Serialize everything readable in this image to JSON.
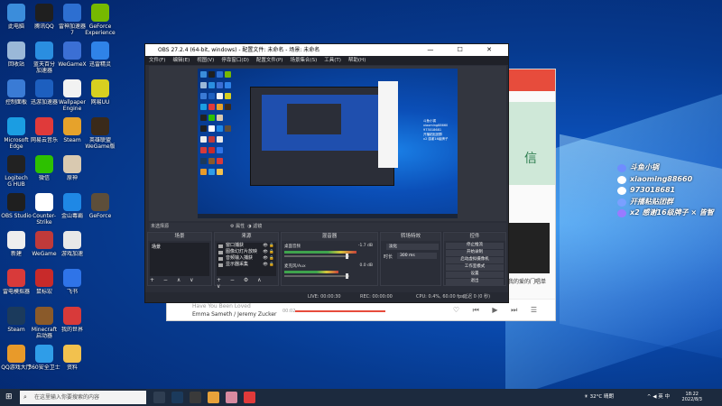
{
  "desktop": {
    "icons": [
      {
        "label": "此电脑",
        "color": "#3b8ddb",
        "col": 0,
        "row": 0
      },
      {
        "label": "腾讯QQ",
        "color": "#1f1f1f",
        "col": 1,
        "row": 0
      },
      {
        "label": "雷神加速器\n7",
        "color": "#2d6fd1",
        "col": 2,
        "row": 0
      },
      {
        "label": "GeForce\nExperience",
        "color": "#76b900",
        "col": 3,
        "row": 0
      },
      {
        "label": "回收站",
        "color": "#9ab8d8",
        "col": 0,
        "row": 1
      },
      {
        "label": "蓝天百分\n加速器",
        "color": "#2a8ee0",
        "col": 1,
        "row": 1
      },
      {
        "label": "WeGameX",
        "color": "#3b6fd4",
        "col": 2,
        "row": 1
      },
      {
        "label": "迅雷精灵",
        "color": "#2f83e8",
        "col": 3,
        "row": 1
      },
      {
        "label": "控制面板",
        "color": "#3a7bd5",
        "col": 0,
        "row": 2
      },
      {
        "label": "迅游加速器",
        "color": "#1d5fbf",
        "col": 1,
        "row": 2
      },
      {
        "label": "Wallpaper\nEngine",
        "color": "#f2f2f2",
        "col": 2,
        "row": 2
      },
      {
        "label": "网易UU",
        "color": "#d8d020",
        "col": 3,
        "row": 2
      },
      {
        "label": "Microsoft\nEdge",
        "color": "#1b9de2",
        "col": 0,
        "row": 3
      },
      {
        "label": "网易云音乐",
        "color": "#e03a3a",
        "col": 1,
        "row": 3
      },
      {
        "label": "Steam",
        "color": "#e6a22b",
        "col": 2,
        "row": 3
      },
      {
        "label": "英雄联盟\nWeGame版",
        "color": "#3a2a1a",
        "col": 3,
        "row": 3
      },
      {
        "label": "Logitech\nG HUB",
        "color": "#222222",
        "col": 0,
        "row": 4
      },
      {
        "label": "微信",
        "color": "#2dc100",
        "col": 1,
        "row": 4
      },
      {
        "label": "原神",
        "color": "#d9c9b0",
        "col": 2,
        "row": 4
      },
      {
        "label": "OBS Studio",
        "color": "#1f1f1f",
        "col": 0,
        "row": 5
      },
      {
        "label": "Counter-\nStrike",
        "color": "#ffffff",
        "col": 1,
        "row": 5
      },
      {
        "label": "金山毒霸",
        "color": "#1f88e5",
        "col": 2,
        "row": 5
      },
      {
        "label": "GeForce",
        "color": "#5d4e3a",
        "col": 3,
        "row": 5
      },
      {
        "label": "新建",
        "color": "#eeeeee",
        "col": 0,
        "row": 6
      },
      {
        "label": "WeGame",
        "color": "#c03a3a",
        "col": 1,
        "row": 6
      },
      {
        "label": "游戏加速",
        "color": "#e8e8e8",
        "col": 2,
        "row": 6
      },
      {
        "label": "雷电模拟器",
        "color": "#d83a3a",
        "col": 0,
        "row": 7
      },
      {
        "label": "鼠标宏",
        "color": "#c82a2a",
        "col": 1,
        "row": 7
      },
      {
        "label": "飞书",
        "color": "#2f74e8",
        "col": 2,
        "row": 7
      },
      {
        "label": "Steam",
        "color": "#1b3a5c",
        "col": 0,
        "row": 8
      },
      {
        "label": "Minecraft\n启动器",
        "color": "#8a5a2a",
        "col": 1,
        "row": 8
      },
      {
        "label": "我的世界",
        "color": "#d83a3a",
        "col": 2,
        "row": 8
      },
      {
        "label": "QQ游戏大厅",
        "color": "#e89a2a",
        "col": 0,
        "row": 9
      },
      {
        "label": "360安全卫士",
        "color": "#2f9de8",
        "col": 1,
        "row": 9
      },
      {
        "label": "资料",
        "color": "#f2c14e",
        "col": 2,
        "row": 9
      }
    ]
  },
  "browser": {
    "green_text": "信",
    "poster_label": "我的爱的门唱单",
    "player": {
      "song": "Have You Been Loved",
      "artist": "Emma Sameth / Jeremy Zucker",
      "time_elapsed": "00:02",
      "time_total": "03:29",
      "controls": "♡ ⏮ ▶ ⏭ ☰"
    }
  },
  "obs": {
    "title": "OBS 27.2.4 (64-bit, windows) - 配置文件: 未命名 - 场景: 未命名",
    "window_controls": "— ☐ ✕",
    "menus": [
      "文件(F)",
      "编辑(E)",
      "视图(V)",
      "停靠窗口(D)",
      "配置文件(P)",
      "场景集合(S)",
      "工具(T)",
      "帮助(H)"
    ],
    "dock_title": "未选择源",
    "dock_props": "⚙ 属性",
    "dock_filters": "◑ 滤镜",
    "scenes": {
      "title": "场景",
      "items": [
        "场景"
      ],
      "footer": "+ − ∧ ∨"
    },
    "sources": {
      "title": "来源",
      "items": [
        {
          "name": "窗口捕获",
          "vis": "👁 🔒"
        },
        {
          "name": "图像幻灯片放映",
          "vis": "👁 🔒"
        },
        {
          "name": "音频输入捕获",
          "vis": "👁 🔒"
        },
        {
          "name": "显示器采集",
          "vis": "👁 🔒"
        }
      ],
      "footer": "+ − ⚙ ∧ ∨"
    },
    "mixer": {
      "title": "混音器",
      "channels": [
        {
          "name": "桌面音频",
          "db": "-1.7 dB",
          "level": 0.8
        },
        {
          "name": "麦克风/Aux",
          "db": "0.0 dB",
          "level": 0.6
        }
      ]
    },
    "transitions": {
      "title": "转场特效",
      "type": "淡化",
      "duration_label": "时长",
      "duration": "300 ms"
    },
    "controls": {
      "title": "控件",
      "buttons": [
        "停止推流",
        "开始录制",
        "启动虚拟摄像机",
        "工作室模式",
        "设置",
        "退出"
      ]
    },
    "status": {
      "live": "LIVE: 00:00:30",
      "rec": "REC: 00:00:00",
      "cpu": "CPU: 0.4%, 60.00 fps",
      "kbps": "延迟 0 (0 秒)",
      "frames": "0 kb/s"
    },
    "preview": {
      "chat_lines": [
        "斗鱼小锅",
        "xiaoming88660",
        "973018681",
        "开播粘贴团群",
        "x2 感谢16级牌子"
      ]
    }
  },
  "chat_overlay": {
    "rows": [
      {
        "text": "斗鱼小锅",
        "badge_color": "#6f8dff"
      },
      {
        "text": "xiaoming88660",
        "badge_color": "#ffffff"
      },
      {
        "text": "973018681",
        "badge_color": "#ffffff"
      },
      {
        "text": "开播粘贴团群",
        "badge_color": "#7aa0ff"
      },
      {
        "text": "x2 感谢16级牌子 × 皆智",
        "badge_color": "#9a7aff"
      }
    ]
  },
  "taskbar": {
    "search_placeholder": "在这里输入你要搜索的内容",
    "apps": [
      {
        "name": "task-view",
        "color": "#2f3e52"
      },
      {
        "name": "steam",
        "color": "#1b3a5c"
      },
      {
        "name": "obs",
        "color": "#3a3a3a"
      },
      {
        "name": "files",
        "color": "#e8a23a"
      },
      {
        "name": "chat",
        "color": "#d88aa0"
      },
      {
        "name": "netease-music",
        "color": "#e03a3a"
      }
    ],
    "weather": "☀ 32°C 晴朗",
    "ime": "^ ◀ 英 中",
    "time": "18:22",
    "date": "2022/8/3"
  }
}
